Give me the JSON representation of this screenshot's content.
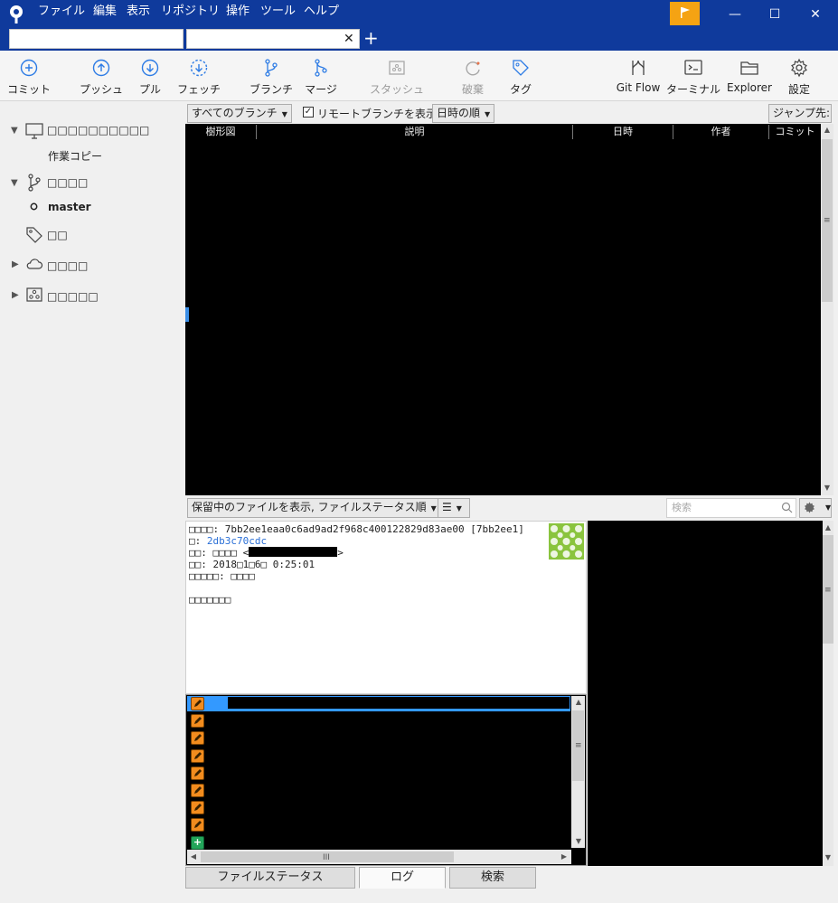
{
  "menu": [
    "ファイル",
    "編集",
    "表示",
    "リポジトリ",
    "操作",
    "ツール",
    "ヘルプ"
  ],
  "window_controls": {
    "minimize": "—",
    "maximize": "☐",
    "close": "✕"
  },
  "tabs": {
    "close": "✕",
    "add": "+"
  },
  "toolbar": [
    {
      "label": "コミット",
      "icon": "commit-icon",
      "disabled": false
    },
    {
      "label": "プッシュ",
      "icon": "push-icon",
      "disabled": false
    },
    {
      "label": "プル",
      "icon": "pull-icon",
      "disabled": false
    },
    {
      "label": "フェッチ",
      "icon": "fetch-icon",
      "disabled": false
    },
    {
      "label": "ブランチ",
      "icon": "branch-icon",
      "disabled": false
    },
    {
      "label": "マージ",
      "icon": "merge-icon",
      "disabled": false
    },
    {
      "label": "スタッシュ",
      "icon": "stash-icon",
      "disabled": true
    },
    {
      "label": "破棄",
      "icon": "discard-icon",
      "disabled": true
    },
    {
      "label": "タグ",
      "icon": "tag-icon",
      "disabled": false
    },
    {
      "label": "Git Flow",
      "icon": "git-flow-icon",
      "disabled": false
    },
    {
      "label": "ターミナル",
      "icon": "terminal-icon",
      "disabled": false
    },
    {
      "label": "Explorer",
      "icon": "explorer-icon",
      "disabled": false
    },
    {
      "label": "設定",
      "icon": "settings-icon",
      "disabled": false
    }
  ],
  "sidebar": {
    "workspace_header": "□□□□□□□□□□",
    "working_copy": "作業コピー",
    "branches_header": "□□□□",
    "branch_master": "master",
    "tags_header": "□□",
    "remotes_header": "□□□□",
    "submodules_header": "□□□□□"
  },
  "filters": {
    "branches_dropdown": "すべてのブランチ",
    "show_remote_label": "リモートブランチを表示",
    "show_remote_checked": true,
    "sort_dropdown": "日時の順",
    "jump_to": "ジャンプ先:"
  },
  "columns": [
    "樹形図",
    "説明",
    "日時",
    "作者",
    "コミット"
  ],
  "bottom_toolbar": {
    "file_options": "保留中のファイルを表示, ファイルステータス順",
    "list_mode_glyph": "☰",
    "search_placeholder": "検索"
  },
  "commit_details": {
    "line_commit": "□□□□: 7bb2ee1eaa0c6ad9ad2f968c400122829d83ae00 [7bb2ee1]",
    "parent_label": "□: ",
    "parent_hash": "2db3c70cdc",
    "author_prefix": "□□: □□□□ <",
    "author_suffix": ">",
    "date_line": "□□: 2018□1□6□ 0:25:01",
    "committer_line": "□□□□□: □□□□",
    "message": "□□□□□□□"
  },
  "file_icons": [
    "modified",
    "modified",
    "modified",
    "modified",
    "modified",
    "modified",
    "modified",
    "modified",
    "added"
  ],
  "bottom_tabs": [
    "ファイルステータス",
    "ログ",
    "検索"
  ],
  "active_tab": "ログ"
}
